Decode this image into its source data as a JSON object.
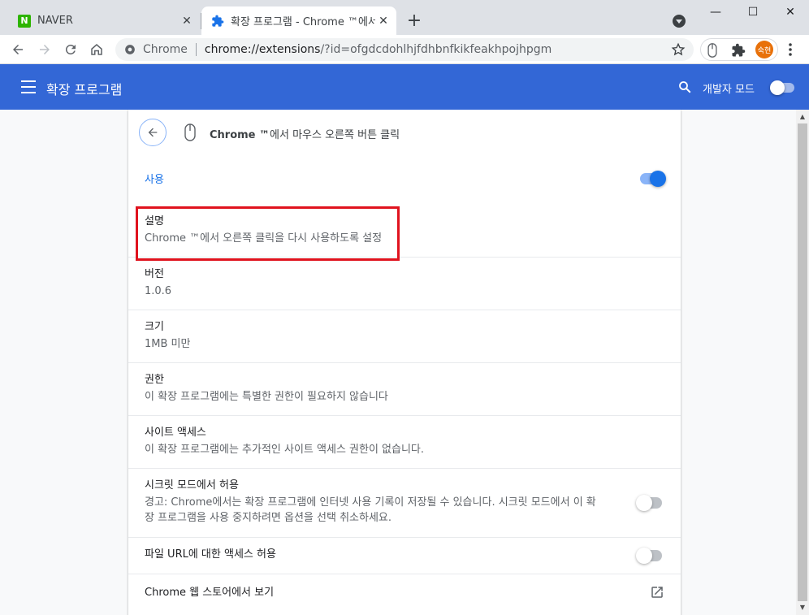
{
  "tabs": [
    {
      "title": "NAVER",
      "favicon": "N",
      "close": "✕"
    },
    {
      "title": "확장 프로그램 - Chrome ™에서 ",
      "close": "✕"
    }
  ],
  "newtab_label": "+",
  "window_controls": {
    "minimize": "—",
    "maximize": "☐",
    "close": "✕"
  },
  "omnibox": {
    "chip": "Chrome",
    "url_host": "chrome://extensions",
    "url_path": "/?id=ofgdcdohlhjfdhbnfkikfeakhpojhpgm"
  },
  "avatar_text": "숙현",
  "appbar": {
    "title": "확장 프로그램",
    "devmode_label": "개발자 모드",
    "devmode_on": false
  },
  "extension": {
    "name_bold": "Chrome ™",
    "name_rest": "에서 마우스 오른쪽 버튼 클릭",
    "enabled_label": "사용",
    "enabled": true
  },
  "details": {
    "description": {
      "label": "설명",
      "value": "Chrome ™에서 오른쪽 클릭을 다시 사용하도록 설정"
    },
    "version": {
      "label": "버전",
      "value": "1.0.6"
    },
    "size": {
      "label": "크기",
      "value": "1MB 미만"
    },
    "permissions": {
      "label": "권한",
      "value": "이 확장 프로그램에는 특별한 권한이 필요하지 않습니다"
    },
    "site_access": {
      "label": "사이트 액세스",
      "value": "이 확장 프로그램에는 추가적인 사이트 액세스 권한이 없습니다."
    },
    "incognito": {
      "label": "시크릿 모드에서 허용",
      "value_line1": "경고: Chrome에서는 확장 프로그램에 인터넷 사용 기록이 저장될 수 있습니다. 시크릿 모드에서 이 확",
      "value_line2": "장 프로그램을 사용 중지하려면 옵션을 선택 취소하세요.",
      "enabled": false
    },
    "file_urls": {
      "label": "파일 URL에 대한 액세스 허용",
      "enabled": false
    },
    "store_link": {
      "label": "Chrome 웹 스토어에서 보기"
    }
  },
  "colors": {
    "appbar": "#3367d6",
    "accent": "#1a73e8",
    "highlight": "#e0131e"
  }
}
